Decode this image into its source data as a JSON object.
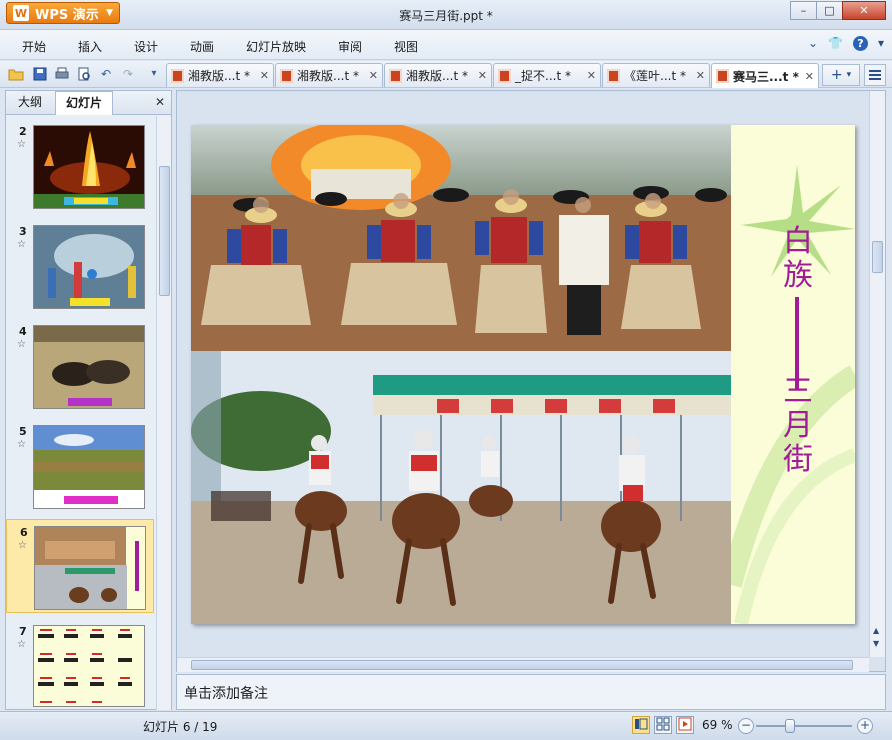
{
  "app": {
    "name": "WPS 演示",
    "logo": "W",
    "document_title": "赛马三月街.ppt *"
  },
  "window_controls": {
    "minimize": "–",
    "maximize": "□",
    "close": "✕"
  },
  "menu": {
    "items": [
      "开始",
      "插入",
      "设计",
      "动画",
      "幻灯片放映",
      "审阅",
      "视图"
    ],
    "right": {
      "collapse": "⌄",
      "skin": "👕",
      "help": "?",
      "help_caret": "▾"
    }
  },
  "toolbar": {
    "more": "▾"
  },
  "doc_tabs": [
    {
      "label": "湘教版...t *",
      "close": "✕",
      "active": false
    },
    {
      "label": "湘教版...t *",
      "close": "✕",
      "active": false
    },
    {
      "label": "湘教版...t *",
      "close": "✕",
      "active": false
    },
    {
      "label": "_捉不...t *",
      "close": "✕",
      "active": false
    },
    {
      "label": "《莲叶...t *",
      "close": "✕",
      "active": false
    },
    {
      "label": "赛马三...t *",
      "close": "✕",
      "active": true
    }
  ],
  "add_tab": "+",
  "left_panel": {
    "tabs": [
      "大纲",
      "幻灯片"
    ],
    "active_tab": "幻灯片",
    "close": "✕",
    "star": "☆",
    "slides": [
      {
        "number": "2"
      },
      {
        "number": "3"
      },
      {
        "number": "4"
      },
      {
        "number": "5"
      },
      {
        "number": "6",
        "selected": true
      },
      {
        "number": "7"
      }
    ]
  },
  "slide": {
    "side_title_1": [
      "白",
      "族"
    ],
    "side_title_2": [
      "三",
      "月",
      "街"
    ]
  },
  "notes": {
    "placeholder": "单击添加备注"
  },
  "status": {
    "slide_position": "幻灯片 6 / 19",
    "zoom": "69 %",
    "zoom_value": 69
  },
  "colors": {
    "accent": "#a21b97",
    "side_bg": "#fbfcd8",
    "selected_thumb": "#fde9a8"
  }
}
